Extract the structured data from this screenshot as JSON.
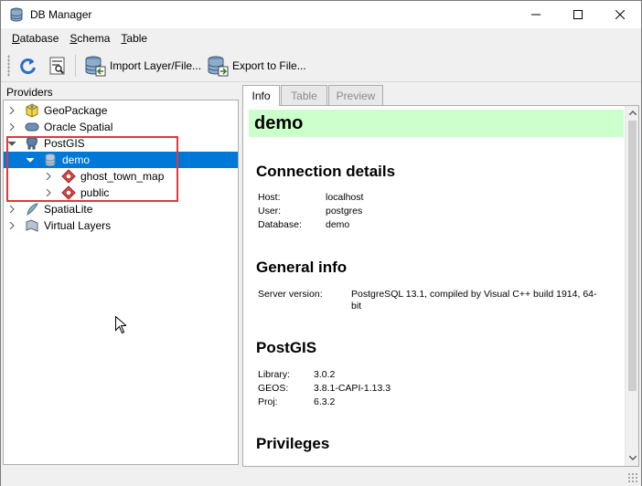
{
  "window": {
    "title": "DB Manager",
    "controls": [
      "minimize",
      "maximize",
      "close"
    ]
  },
  "menubar": {
    "items": [
      {
        "first": "D",
        "rest": "atabase"
      },
      {
        "first": "S",
        "rest": "chema"
      },
      {
        "first": "T",
        "rest": "able"
      }
    ]
  },
  "toolbar": {
    "refresh_icon": "refresh-icon",
    "sql_icon": "sql-window-icon",
    "import_label": "Import Layer/File...",
    "export_label": "Export to File..."
  },
  "providers": {
    "title": "Providers",
    "items": [
      {
        "label": "GeoPackage",
        "icon": "geopackage-icon"
      },
      {
        "label": "Oracle Spatial",
        "icon": "oracle-icon"
      },
      {
        "label": "PostGIS",
        "icon": "postgis-icon"
      },
      {
        "label": "demo",
        "icon": "database-icon"
      },
      {
        "label": "ghost_town_map",
        "icon": "schema-icon"
      },
      {
        "label": "public",
        "icon": "schema-icon"
      },
      {
        "label": "SpatiaLite",
        "icon": "spatialite-icon"
      },
      {
        "label": "Virtual Layers",
        "icon": "virtual-layer-icon"
      }
    ]
  },
  "tabs": [
    {
      "label": "Info",
      "active": true
    },
    {
      "label": "Table",
      "active": false
    },
    {
      "label": "Preview",
      "active": false
    }
  ],
  "info": {
    "title": "demo",
    "connection": {
      "heading": "Connection details",
      "host_label": "Host:",
      "host_value": "localhost",
      "user_label": "User:",
      "user_value": "postgres",
      "db_label": "Database:",
      "db_value": "demo"
    },
    "general": {
      "heading": "General info",
      "server_label": "Server version:",
      "server_value_1": "PostgreSQL 13.1, compiled by Visual C++ build 1914, 64-",
      "server_value_2": "bit"
    },
    "postgis": {
      "heading": "PostGIS",
      "library_label": "Library:",
      "library_value": "3.0.2",
      "geos_label": "GEOS:",
      "geos_value": "3.8.1-CAPI-1.13.3",
      "proj_label": "Proj:",
      "proj_value": "6.3.2"
    },
    "privileges": {
      "heading": "Privileges"
    }
  },
  "colors": {
    "selection": "#0078d7",
    "title_bg": "#ccffcc",
    "highlight_box": "#e0383e"
  }
}
